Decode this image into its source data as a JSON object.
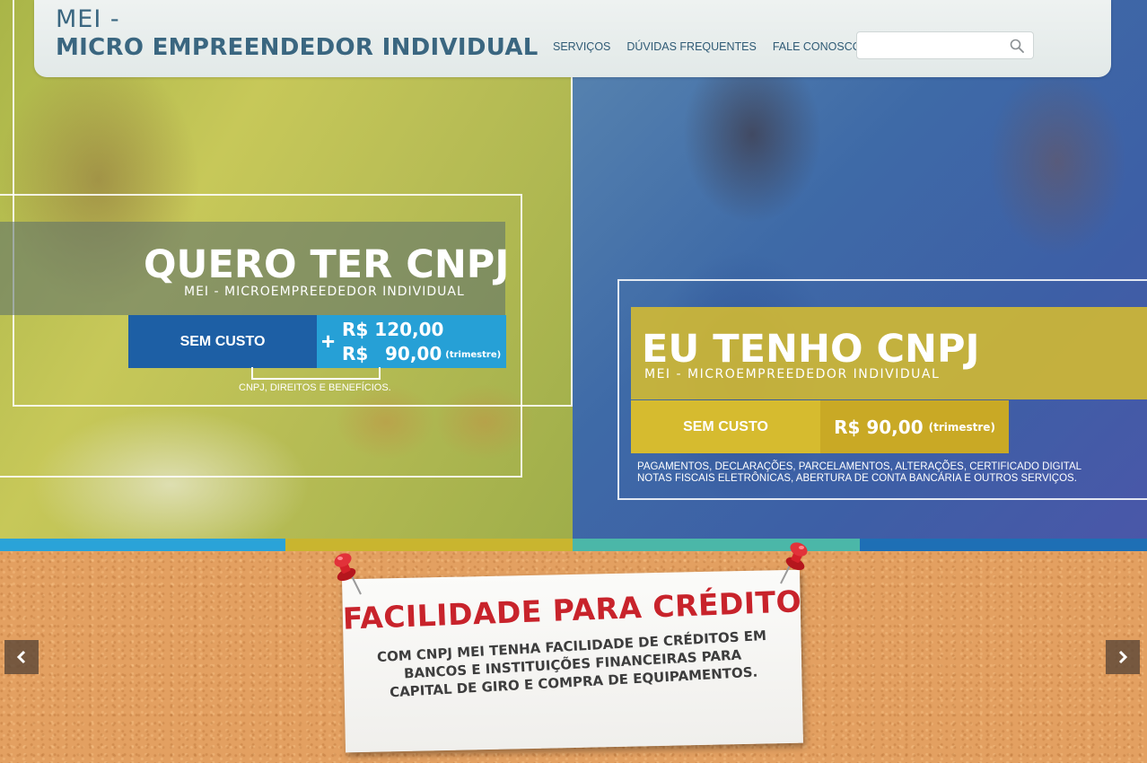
{
  "header": {
    "brand_line1": "MEI -",
    "brand_line2": "MICRO EMPREENDEDOR INDIVIDUAL",
    "nav": [
      "SERVIÇOS",
      "DÚVIDAS FREQUENTES",
      "FALE CONOSCO"
    ],
    "search": {
      "value": "",
      "placeholder": ""
    }
  },
  "left_panel": {
    "title": "QUERO TER CNPJ",
    "subtitle": "MEI - MICROEMPREEDEDOR INDIVIDUAL",
    "button_label": "SEM CUSTO",
    "plus": "+",
    "price1": "R$ 120,00",
    "price2_currency": "R$",
    "price2_value": "90,00",
    "price2_note": "(trimestre)",
    "note": "CNPJ, DIREITOS E BENEFÍCIOS."
  },
  "right_panel": {
    "title": "EU TENHO CNPJ",
    "subtitle": "MEI - MICROEMPREEDEDOR INDIVIDUAL",
    "button_label": "SEM CUSTO",
    "price": "R$ 90,00",
    "price_note": "(trimestre)",
    "note_line1": "PAGAMENTOS, DECLARAÇÕES, PARCELAMENTOS, ALTERAÇÕES, CERTIFICADO DIGITAL",
    "note_line2": "NOTAS FISCAIS ELETRÔNICAS, ABERTURA DE CONTA BANCÁRIA E OUTROS SERVIÇOS."
  },
  "stripes": [
    "#2aa3d8",
    "#c9b52f",
    "#4bb7a8",
    "#1e6fb5"
  ],
  "slider": {
    "title": "FACILIDADE PARA CRÉDITO",
    "body_lines": [
      "COM CNPJ MEI TENHA FACILIDADE DE CRÉDITOS EM",
      "BANCOS E  INSTITUIÇÕES FINANCEIRAS PARA",
      "CAPITAL DE GIRO E COMPRA DE EQUIPAMENTOS."
    ],
    "prev_icon": "chevron-left-icon",
    "next_icon": "chevron-right-icon"
  },
  "colors": {
    "brand_blue": "#3a6680",
    "button_blue": "#1d5fa5",
    "price_blue": "#26a0d6",
    "button_yellow": "#d6bb2f",
    "credit_red": "#c8232b",
    "cork": "#e3a061"
  }
}
